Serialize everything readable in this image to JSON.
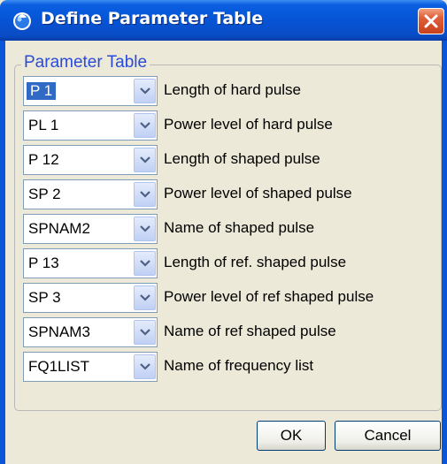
{
  "window": {
    "title": "Define Parameter Table",
    "icon": "app-droplet-icon",
    "close_icon": "close-x-icon"
  },
  "group": {
    "legend": "Parameter Table"
  },
  "rows": [
    {
      "value": "P 1",
      "label": "Length of hard pulse",
      "selected": true
    },
    {
      "value": "PL 1",
      "label": "Power level of hard pulse"
    },
    {
      "value": "P 12",
      "label": "Length of shaped pulse"
    },
    {
      "value": "SP 2",
      "label": "Power level of shaped pulse"
    },
    {
      "value": "SPNAM2",
      "label": "Name of shaped pulse"
    },
    {
      "value": "P 13",
      "label": "Length of ref. shaped pulse"
    },
    {
      "value": "SP 3",
      "label": "Power level of ref shaped pulse"
    },
    {
      "value": "SPNAM3",
      "label": "Name of ref shaped pulse"
    },
    {
      "value": "FQ1LIST",
      "label": "Name of frequency list"
    }
  ],
  "buttons": {
    "ok": "OK",
    "cancel": "Cancel"
  },
  "colors": {
    "titlebar": "#0654d6",
    "legend": "#2a4ad8",
    "selection": "#316ac5",
    "close": "#e0603a"
  }
}
